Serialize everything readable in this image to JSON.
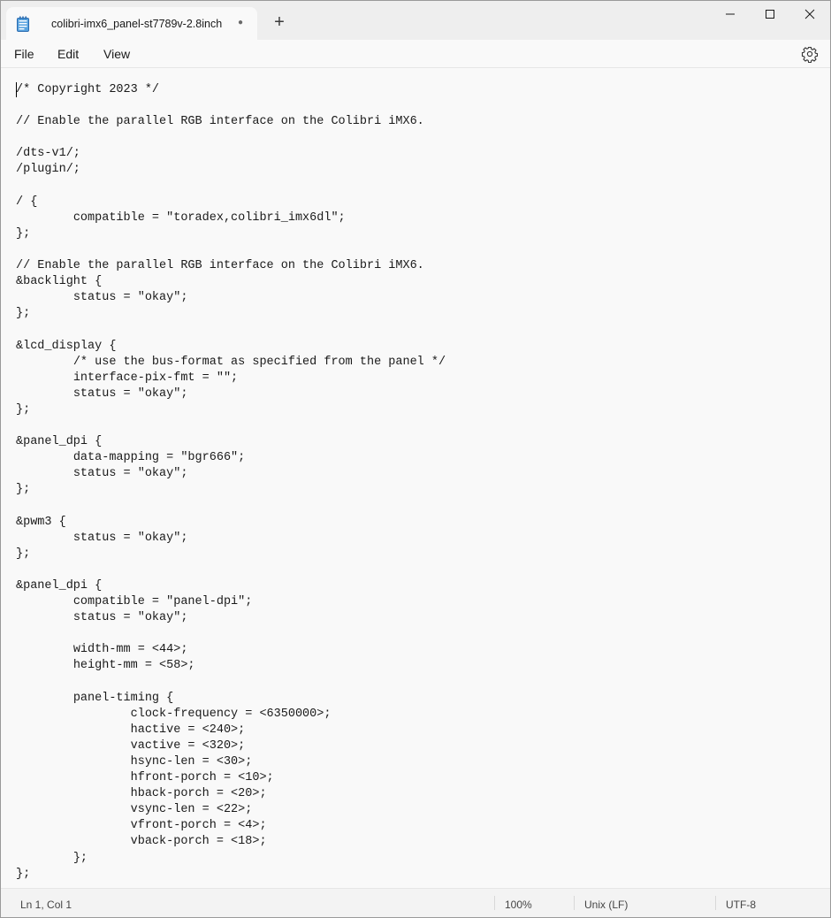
{
  "window": {
    "tab_title": "colibri-imx6_panel-st7789v-2.8inch",
    "unsaved_indicator": "●",
    "new_tab_label": "+",
    "icons": {
      "app": "notepad-icon",
      "minimize": "minimize-icon",
      "maximize": "maximize-icon",
      "close": "close-icon",
      "settings": "gear-icon"
    }
  },
  "menu": {
    "file": "File",
    "edit": "Edit",
    "view": "View"
  },
  "editor": {
    "content": "/* Copyright 2023 */\n\n// Enable the parallel RGB interface on the Colibri iMX6.\n\n/dts-v1/;\n/plugin/;\n\n/ {\n\tcompatible = \"toradex,colibri_imx6dl\";\n};\n\n// Enable the parallel RGB interface on the Colibri iMX6.\n&backlight {\n\tstatus = \"okay\";\n};\n\n&lcd_display {\n\t/* use the bus-format as specified from the panel */\n\tinterface-pix-fmt = \"\";\n\tstatus = \"okay\";\n};\n\n&panel_dpi {\n\tdata-mapping = \"bgr666\";\n\tstatus = \"okay\";\n};\n\n&pwm3 {\n\tstatus = \"okay\";\n};\n\n&panel_dpi {\n\tcompatible = \"panel-dpi\";\n\tstatus = \"okay\";\n\n\twidth-mm = <44>;\n\theight-mm = <58>;\n\n\tpanel-timing {\n\t\tclock-frequency = <6350000>;\n\t\thactive = <240>;\n\t\tvactive = <320>;\n\t\thsync-len = <30>;\n\t\thfront-porch = <10>;\n\t\thback-porch = <20>;\n\t\tvsync-len = <22>;\n\t\tvfront-porch = <4>;\n\t\tvback-porch = <18>;\n\t};\n};"
  },
  "status": {
    "position": "Ln 1, Col 1",
    "zoom": "100%",
    "line_ending": "Unix (LF)",
    "encoding": "UTF-8"
  }
}
